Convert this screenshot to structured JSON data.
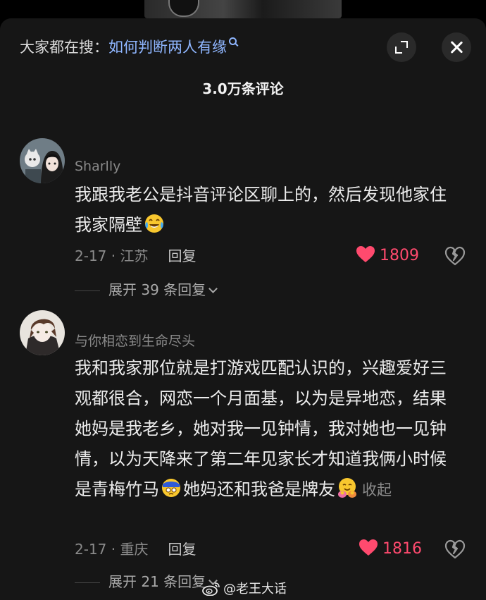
{
  "header": {
    "label": "大家都在搜：",
    "search_term": "如何判断两人有缘"
  },
  "comment_count": "3.0万条评论",
  "comments": [
    {
      "username": "Sharlly",
      "text": "我跟我老公是抖音评论区聊上的，然后发现他家住我家隔壁",
      "emoji": "laugh-cry-emoji",
      "date_location": "2-17 · 江苏",
      "reply_label": "回复",
      "likes": "1809",
      "expand_replies": "展开 39 条回复"
    },
    {
      "username": "与你相恋到生命尽头",
      "text_part1": "我和我家那位就是打游戏匹配认识的，兴趣爱好三观都很合，网恋一个月面基，以为是异地恋，结果她妈是我老乡，她对我一见钟情，我对她也一见钟情，以为天降来了第二年见家长才知道我俩小时候是青梅竹马",
      "emoji1": "dizzy-face-emoji",
      "text_part2": "她妈还和我爸是牌友",
      "emoji2": "hugging-emoji",
      "collapse_label": "收起",
      "date_location": "2-17 · 重庆",
      "reply_label": "回复",
      "likes": "1816",
      "expand_replies": "展开 21 条回复"
    }
  ],
  "watermark": "@老王大话",
  "colors": {
    "background": "#161616",
    "search_term": "#8fb6ff",
    "like": "#ff4a6e",
    "muted_text": "#8a8a8a"
  }
}
